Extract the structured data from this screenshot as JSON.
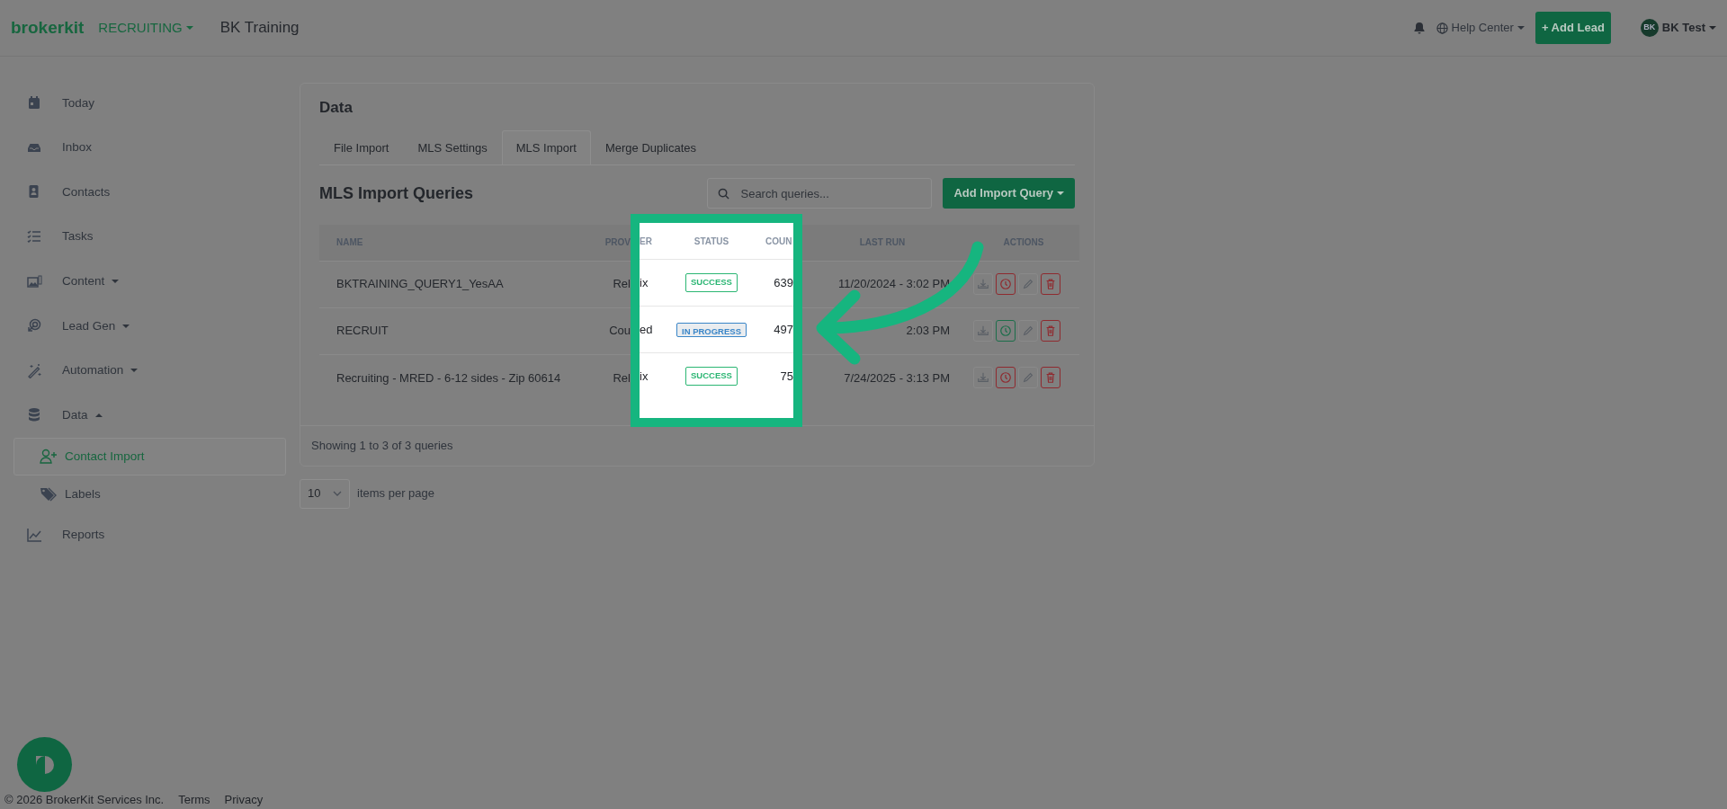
{
  "topbar": {
    "brand": "brokerkit",
    "workspace": "RECRUITING",
    "org": "BK Training",
    "help": "Help Center",
    "add_lead": "+ Add Lead",
    "avatar": "BK",
    "user": "BK Test"
  },
  "sidebar": {
    "items": [
      {
        "label": "Today",
        "selected": false
      },
      {
        "label": "Inbox",
        "selected": false
      },
      {
        "label": "Contacts",
        "selected": false
      },
      {
        "label": "Tasks",
        "selected": false
      },
      {
        "label": "Content",
        "selected": false,
        "expanded": false
      },
      {
        "label": "Lead Gen",
        "selected": false,
        "expanded": false
      },
      {
        "label": "Automation",
        "selected": false,
        "expanded": false
      },
      {
        "label": "Data",
        "selected": false,
        "expanded": true,
        "children": [
          {
            "label": "Contact Import",
            "selected": true
          },
          {
            "label": "Labels",
            "selected": false
          }
        ]
      },
      {
        "label": "Reports",
        "selected": false
      }
    ]
  },
  "card": {
    "title": "Data",
    "tabs": [
      {
        "label": "File Import",
        "selected": false
      },
      {
        "label": "MLS Settings",
        "selected": false
      },
      {
        "label": "MLS Import",
        "selected": true
      },
      {
        "label": "Merge Duplicates",
        "selected": false
      }
    ],
    "heading": "MLS Import Queries",
    "search": {
      "placeholder": "Search queries..."
    },
    "add_button": "Add Import Query",
    "table": {
      "columns": [
        "NAME",
        "PROV",
        "LAST RUN",
        "ACTIONS"
      ],
      "rows": [
        {
          "name": "BKTRAINING_QUERY1_YesAA",
          "provider": "Rel",
          "last_run": "11/20/2024 - 3:02 PM",
          "running": false
        },
        {
          "name": "RECRUIT",
          "provider": "Cou",
          "last_run": "2:03 PM",
          "running": true
        },
        {
          "name": "Recruiting - MRED - 6-12 sides - Zip 60614",
          "provider": "Rel",
          "last_run": "7/24/2025 - 3:13 PM",
          "running": false
        }
      ]
    },
    "highlight": {
      "columns": [
        "ER",
        "STATUS",
        "COUN"
      ],
      "rows": [
        {
          "provider": "ix",
          "status": "SUCCESS",
          "kind": "success",
          "count": "639"
        },
        {
          "provider": "ed",
          "status": "IN PROGRESS",
          "kind": "progress",
          "count": "497"
        },
        {
          "provider": "ix",
          "status": "SUCCESS",
          "kind": "success",
          "count": "75"
        }
      ]
    },
    "summary": "Showing 1 to 3 of 3 queries"
  },
  "pager": {
    "value": "10",
    "label": "items per page"
  },
  "footer": {
    "copyright": "© 2026 BrokerKit Services Inc.",
    "links": [
      "Terms",
      "Privacy"
    ]
  }
}
